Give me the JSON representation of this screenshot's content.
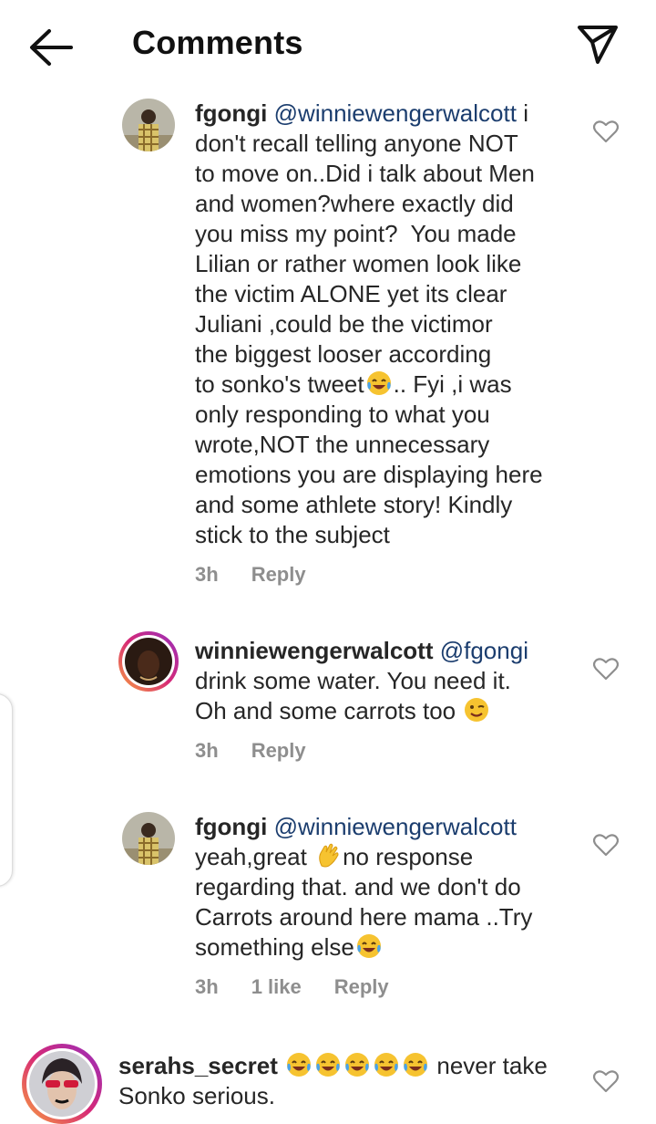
{
  "header": {
    "title": "Comments",
    "back_icon": "arrow-left-icon",
    "send_icon": "paper-plane-icon"
  },
  "comments": [
    {
      "username": "fgongi",
      "mention": "@winniewengerwalcott",
      "text_before_emoji": "i\ndon't recall telling anyone NOT\nto move on..Did i talk about Men\nand women?where exactly did\nyou miss my point?  You made\nLilian or rather women look like\nthe victim ALONE yet its clear\nJuliani ,could be the victimor\nthe biggest looser according\nto sonko's tweet",
      "emoji_1": "face-with-tears-of-joy",
      "text_after_emoji": ".. Fyi ,i was\nonly responding to what you\nwrote,NOT the unnecessary\nemotions you are displaying here\nand some athlete story! Kindly\nstick to the subject",
      "time": "3h",
      "reply": "Reply"
    },
    {
      "username": "winniewengerwalcott",
      "mention": "@fgongi",
      "text_before_emoji": "\ndrink some water. You need it.\nOh and some carrots too ",
      "emoji_1": "winking-face",
      "time": "3h",
      "reply": "Reply"
    },
    {
      "username": "fgongi",
      "mention": "@winniewengerwalcott",
      "text_before_emoji": "\nyeah,great ",
      "emoji_1": "waving-hand",
      "text_after_emoji": "no response\nregarding that. and we don't do\nCarrots around here mama ..Try\nsomething else",
      "emoji_2": "face-with-tears-of-joy",
      "time": "3h",
      "likes": "1 like",
      "reply": "Reply"
    },
    {
      "username": "serahs_secret",
      "emoji_1": "face-with-tears-of-joy x5",
      "text_after_emoji": " never take\nSonko serious."
    }
  ]
}
